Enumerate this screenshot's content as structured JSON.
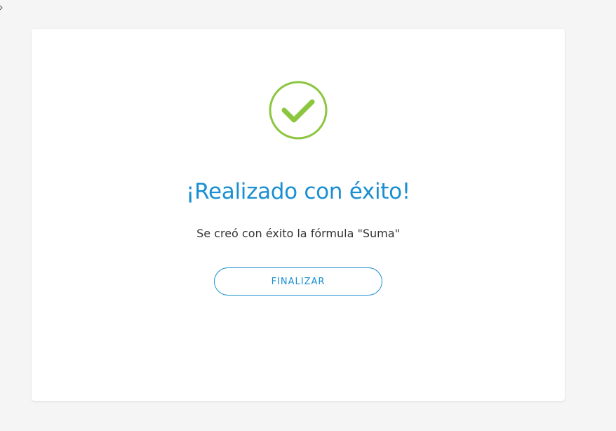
{
  "colors": {
    "accent": "#1a8fd1",
    "success": "#8cc63f",
    "text": "#333333",
    "background": "#f5f5f5",
    "card": "#ffffff"
  },
  "dialog": {
    "icon": "check-circle-icon",
    "title": "¡Realizado con éxito!",
    "message": "Se creó con éxito la fórmula \"Suma\"",
    "finish_label": "FINALIZAR"
  }
}
